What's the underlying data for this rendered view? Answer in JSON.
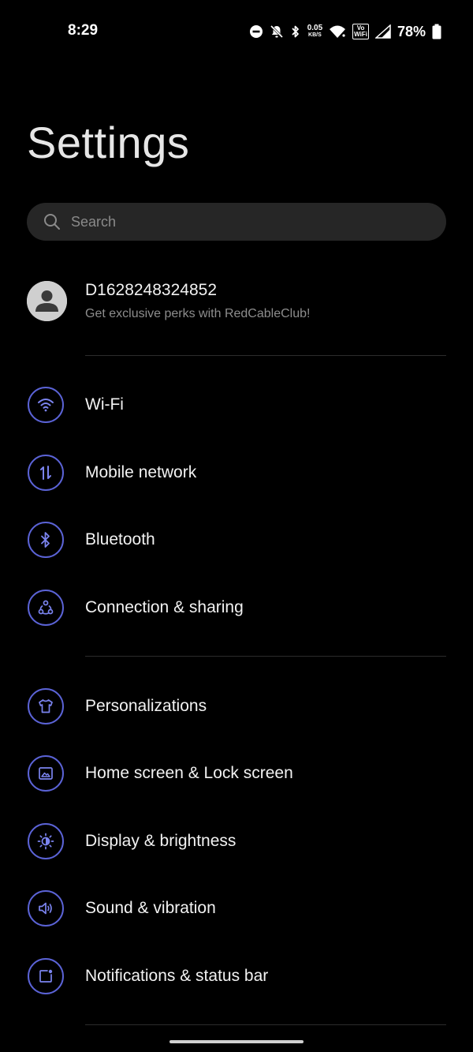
{
  "status_bar": {
    "time": "8:29",
    "net_speed_value": "0.05",
    "net_speed_unit": "KB/S",
    "volte_top": "Vo",
    "volte_bottom": "WiFi",
    "battery_percent": "78%"
  },
  "title": "Settings",
  "search": {
    "placeholder": "Search"
  },
  "account": {
    "name": "D1628248324852",
    "subtitle": "Get exclusive perks with RedCableClub!"
  },
  "sections": [
    {
      "items": [
        {
          "label": "Wi-Fi",
          "icon": "wifi-icon"
        },
        {
          "label": "Mobile network",
          "icon": "mobile-data-icon"
        },
        {
          "label": "Bluetooth",
          "icon": "bluetooth-icon"
        },
        {
          "label": "Connection & sharing",
          "icon": "connection-sharing-icon"
        }
      ]
    },
    {
      "items": [
        {
          "label": "Personalizations",
          "icon": "tshirt-icon"
        },
        {
          "label": "Home screen & Lock screen",
          "icon": "wallpaper-icon"
        },
        {
          "label": "Display & brightness",
          "icon": "brightness-icon"
        },
        {
          "label": "Sound & vibration",
          "icon": "speaker-icon"
        },
        {
          "label": "Notifications & status bar",
          "icon": "notification-icon"
        }
      ]
    }
  ],
  "colors": {
    "background": "#000000",
    "icon_accent": "#5b63d6",
    "search_bg": "#262626",
    "subtitle": "#8d8d8d"
  }
}
